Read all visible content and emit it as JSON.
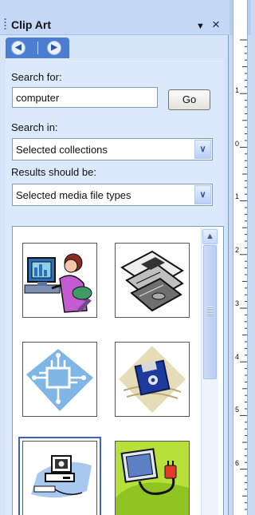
{
  "pane": {
    "title": "Clip Art",
    "icons": {
      "dropdown": "dropdown-arrow-icon",
      "close": "close-icon",
      "back": "back-arrow-icon",
      "forward": "forward-arrow-icon"
    }
  },
  "search": {
    "label": "Search for:",
    "value": "computer",
    "go_label": "Go"
  },
  "search_in": {
    "label": "Search in:",
    "selected": "Selected collections"
  },
  "results_type": {
    "label": "Results should be:",
    "selected": "Selected media file types"
  },
  "results": {
    "items": [
      {
        "name": "woman-at-computer"
      },
      {
        "name": "floppy-disks"
      },
      {
        "name": "circuit-board"
      },
      {
        "name": "floppy-disk"
      },
      {
        "name": "computer-hardware"
      },
      {
        "name": "plug-and-computer"
      }
    ]
  },
  "ruler": {
    "numbers": [
      "1",
      "0",
      "1",
      "2",
      "3",
      "4",
      "5",
      "6"
    ]
  },
  "colors": {
    "pane_bg": "#d6e4fa",
    "nav_accent": "#4b7ed1",
    "selection": "#3a66b8"
  }
}
